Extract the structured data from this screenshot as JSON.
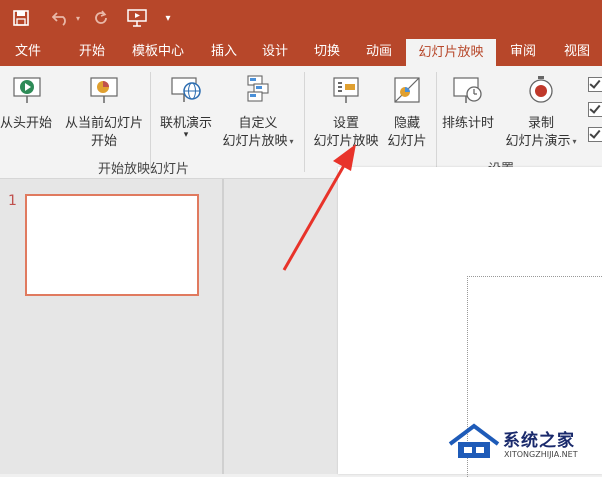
{
  "quick_access": {
    "save_icon": "save-icon",
    "undo_icon": "undo-icon",
    "redo_icon": "redo-icon",
    "present_icon": "present-from-beginning-icon",
    "customize_icon": "customize-qat-icon"
  },
  "tabs": [
    "文件",
    "开始",
    "模板中心",
    "插入",
    "设计",
    "切换",
    "动画",
    "幻灯片放映",
    "审阅",
    "视图"
  ],
  "active_tab": "幻灯片放映",
  "ribbon": {
    "start_group": {
      "label": "开始放映幻灯片",
      "from_beginning": {
        "line1": "从头开始",
        "icon": "play-from-start-icon"
      },
      "from_current": {
        "line1": "从当前幻灯片",
        "line2": "开始",
        "icon": "play-from-current-icon"
      },
      "online": {
        "line1": "联机演示",
        "line2": "▾",
        "icon": "present-online-icon"
      },
      "custom": {
        "line1": "自定义",
        "line2": "幻灯片放映",
        "icon": "custom-show-icon"
      }
    },
    "setup_group": {
      "label": "设置",
      "setup_show": {
        "line1": "设置",
        "line2": "幻灯片放映",
        "icon": "setup-slideshow-icon"
      },
      "hide_slide": {
        "line1": "隐藏",
        "line2": "幻灯片",
        "icon": "hide-slide-icon"
      },
      "rehearse": {
        "line1": "排练计时",
        "icon": "stopwatch-icon"
      },
      "record": {
        "line1": "录制",
        "line2": "幻灯片演示",
        "icon": "record-icon"
      }
    },
    "checkboxes": [
      true,
      true,
      true
    ]
  },
  "slides_pane": {
    "slide_number": "1"
  },
  "watermark": {
    "title": "系统之家",
    "subtitle": "XITONGZHIJIA.NET"
  },
  "colors": {
    "accent": "#b7472a",
    "arrow": "#e8332a"
  }
}
